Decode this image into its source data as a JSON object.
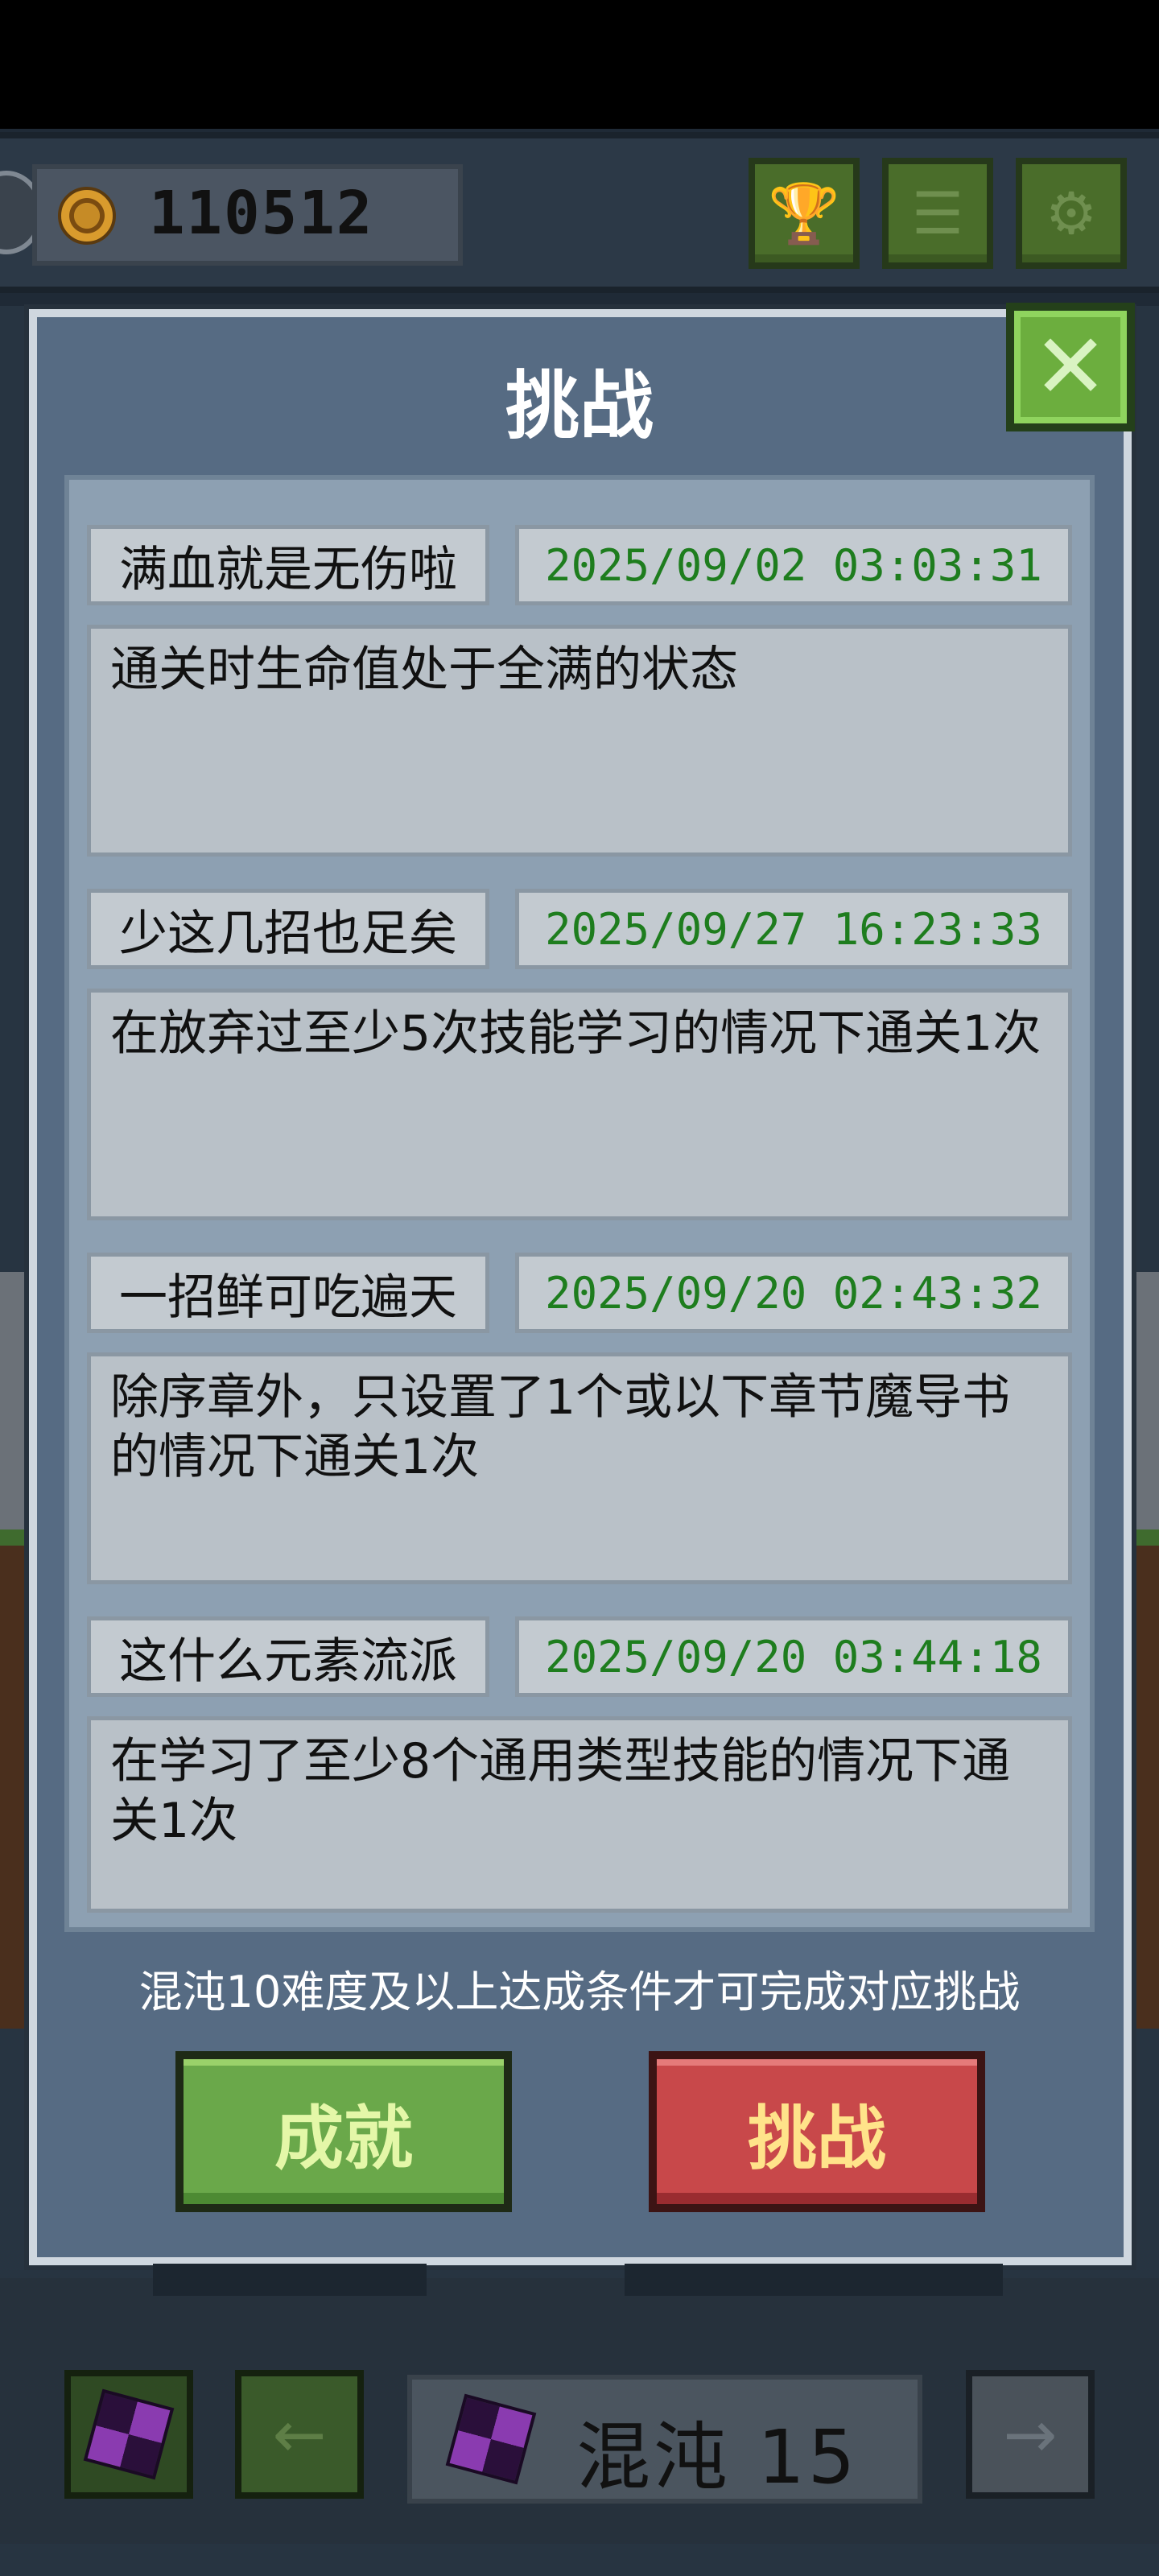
{
  "hud": {
    "coins": "110512",
    "buttons": [
      "trophy-icon",
      "list-icon",
      "gear-icon"
    ]
  },
  "dialog": {
    "title": "挑战",
    "challenges": [
      {
        "name": "满血就是无伤啦",
        "time": "2025/09/02 03:03:31",
        "desc": "通关时生命值处于全满的状态"
      },
      {
        "name": "少这几招也足矣",
        "time": "2025/09/27 16:23:33",
        "desc": "在放弃过至少5次技能学习的情况下通关1次"
      },
      {
        "name": "一招鲜可吃遍天",
        "time": "2025/09/20 02:43:32",
        "desc": "除序章外，只设置了1个或以下章节魔导书的情况下通关1次"
      },
      {
        "name": "这什么元素流派",
        "time": "2025/09/20 03:44:18",
        "desc": "在学习了至少8个通用类型技能的情况下通关1次"
      }
    ],
    "hint": "混沌10难度及以上达成条件才可完成对应挑战",
    "achievement_button": "成就",
    "challenge_button": "挑战"
  },
  "bottom": {
    "mode_label": "混沌 15",
    "left_arrow": "←",
    "right_arrow": "→"
  },
  "colors": {
    "time_green": "#1e7d1e",
    "achievement_green": "#6aa84a",
    "challenge_red": "#c8484a"
  }
}
